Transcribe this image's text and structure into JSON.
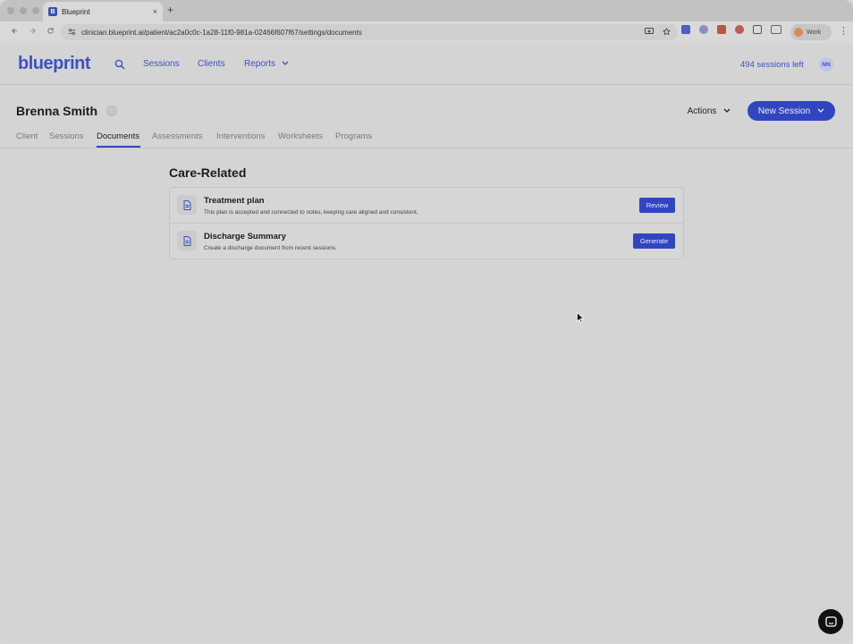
{
  "browser": {
    "tab_title": "Blueprint",
    "tab_favicon": "B",
    "new_tab": "+",
    "close_tab": "×",
    "url": "clinician.blueprint.ai/patient/ac2a0c0c-1a28-11f0-981a-02466f607f67/settings/documents",
    "profile_label": "Work"
  },
  "app": {
    "logo": "blueprint",
    "nav": [
      "Sessions",
      "Clients",
      "Reports"
    ],
    "sessions_left": "494 sessions left",
    "avatar_initials": "NN",
    "accent_color": "#3245c0"
  },
  "patient": {
    "name": "Brenna Smith",
    "actions_label": "Actions",
    "new_session_label": "New Session",
    "tabs": [
      "Client",
      "Sessions",
      "Documents",
      "Assessments",
      "Interventions",
      "Worksheets",
      "Programs"
    ],
    "active_tab": "Documents"
  },
  "section": {
    "title": "Care-Related",
    "documents": [
      {
        "title": "Treatment plan",
        "description": "This plan is accepted and connected to notes, keeping care aligned and consistent.",
        "action": "Review"
      },
      {
        "title": "Discharge Summary",
        "description": "Create a discharge document from recent sessions.",
        "action": "Generate"
      }
    ]
  }
}
